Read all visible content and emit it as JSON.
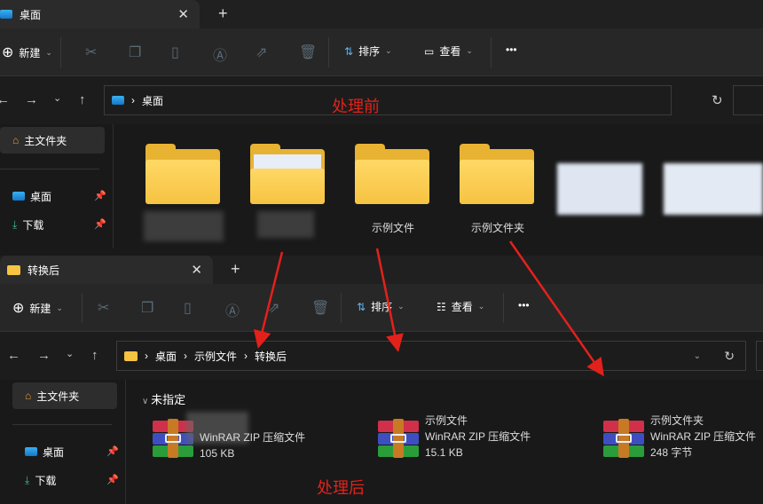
{
  "top_window": {
    "tab_title": "桌面",
    "toolbar": {
      "new": "新建",
      "sort": "排序",
      "view": "查看",
      "more": "•••"
    },
    "address": {
      "crumbs": [
        "桌面"
      ]
    },
    "sidebar": {
      "home": "主文件夹",
      "items": [
        {
          "label": "桌面"
        },
        {
          "label": "下载"
        }
      ]
    },
    "files": [
      {
        "name": "示例文件"
      },
      {
        "name": "示例文件夹"
      }
    ],
    "annotation": "处理前"
  },
  "bottom_window": {
    "tab_title": "转换后",
    "toolbar": {
      "new": "新建",
      "sort": "排序",
      "view": "查看",
      "more": "•••"
    },
    "address": {
      "crumbs": [
        "桌面",
        "示例文件",
        "转换后"
      ]
    },
    "sidebar": {
      "home": "主文件夹",
      "items": [
        {
          "label": "桌面"
        },
        {
          "label": "下载"
        }
      ]
    },
    "group": "未指定",
    "files": [
      {
        "name": "",
        "type": "WinRAR ZIP 压缩文件",
        "size": "105 KB"
      },
      {
        "name": "示例文件",
        "type": "WinRAR ZIP 压缩文件",
        "size": "15.1 KB"
      },
      {
        "name": "示例文件夹",
        "type": "WinRAR ZIP 压缩文件",
        "size": "248 字节"
      }
    ],
    "annotation": "处理后"
  },
  "colors": {
    "annotation": "#e3211b",
    "folder": "#f6c342"
  }
}
